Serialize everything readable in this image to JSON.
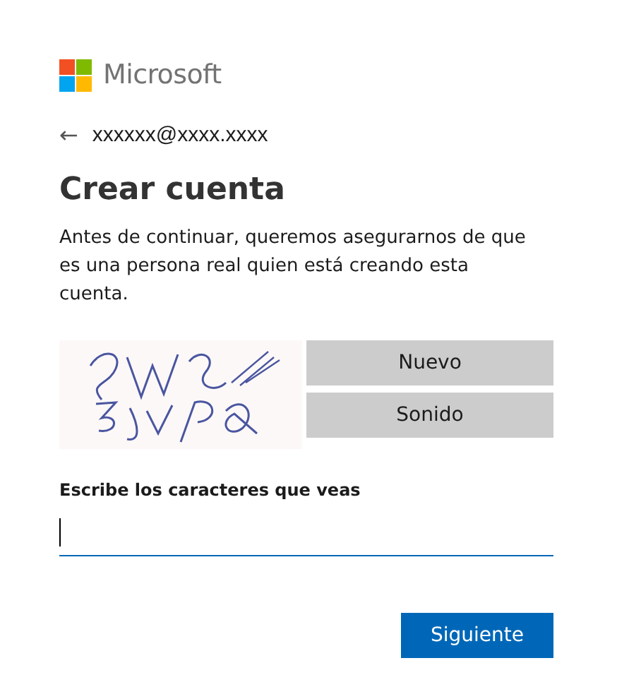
{
  "brand": {
    "name": "Microsoft"
  },
  "identity": {
    "back": "←",
    "email": "xxxxxx@xxxx.xxxx"
  },
  "title": "Crear cuenta",
  "description": "Antes de continuar, queremos asegurarnos de que es una persona real quien está creando esta cuenta.",
  "captcha": {
    "buttons": [
      "Nuevo",
      "Sonido"
    ]
  },
  "field": {
    "label": "Escribe los caracteres que veas",
    "focused": true
  },
  "buttons": [
    "Siguiente"
  ]
}
